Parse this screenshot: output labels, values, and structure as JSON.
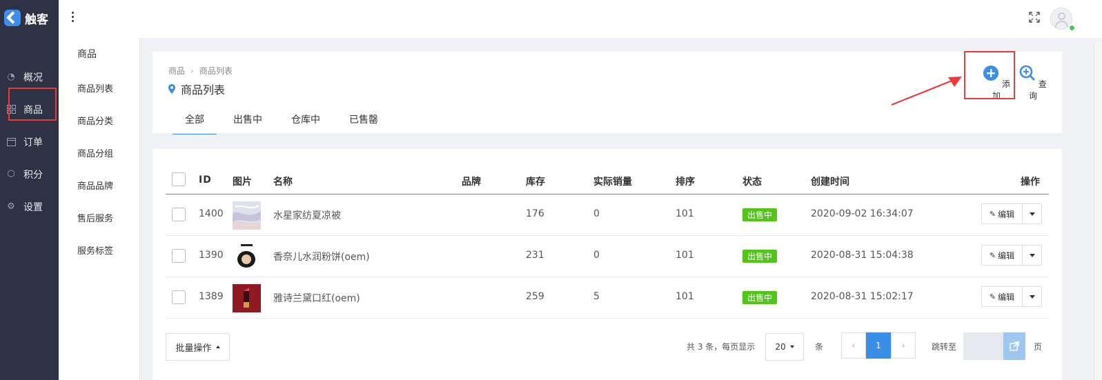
{
  "app": {
    "name": "触客"
  },
  "colors": {
    "sidebar": "#2e3245",
    "accent": "#3a8ee6",
    "status_green": "#52c41a",
    "highlight_red": "#e83b3b"
  },
  "sidebar": {
    "items": [
      {
        "label": "概况",
        "icon": "dashboard-icon"
      },
      {
        "label": "商品",
        "icon": "grid-icon"
      },
      {
        "label": "订单",
        "icon": "calendar-icon"
      },
      {
        "label": "积分",
        "icon": "cube-icon"
      },
      {
        "label": "设置",
        "icon": "gear-icon"
      }
    ]
  },
  "subnav": {
    "title": "商品",
    "items": [
      "商品列表",
      "商品分类",
      "商品分组",
      "商品品牌",
      "售后服务",
      "服务标签"
    ]
  },
  "breadcrumb": {
    "root": "商品",
    "sep": "›",
    "current": "商品列表"
  },
  "page_title": "商品列表",
  "tabs": [
    "全部",
    "出售中",
    "仓库中",
    "已售罄"
  ],
  "actions": {
    "add": "添加",
    "query": "查询"
  },
  "table": {
    "headers": {
      "id": "ID",
      "image": "图片",
      "name": "名称",
      "brand": "品牌",
      "stock": "库存",
      "sales": "实际销量",
      "sort": "排序",
      "status": "状态",
      "created": "创建时间",
      "ops": "操作"
    },
    "rows": [
      {
        "id": "1400",
        "name": "水星家纺夏凉被",
        "brand": "",
        "stock": "176",
        "sales": "0",
        "sort": "101",
        "status": "出售中",
        "created": "2020-09-02 16:34:07",
        "edit": "编辑"
      },
      {
        "id": "1390",
        "name": "香奈儿水润粉饼(oem)",
        "brand": "",
        "stock": "231",
        "sales": "0",
        "sort": "101",
        "status": "出售中",
        "created": "2020-08-31 15:04:38",
        "edit": "编辑"
      },
      {
        "id": "1389",
        "name": "雅诗兰黛口红(oem)",
        "brand": "",
        "stock": "259",
        "sales": "5",
        "sort": "101",
        "status": "出售中",
        "created": "2020-08-31 15:02:17",
        "edit": "编辑"
      }
    ]
  },
  "footer": {
    "batch": "批量操作",
    "total_text": "共 3 条，每页显示",
    "page_size": "20",
    "page_unit": "条",
    "current_page": "1",
    "jump_label": "跳转至",
    "page_label": "页"
  }
}
